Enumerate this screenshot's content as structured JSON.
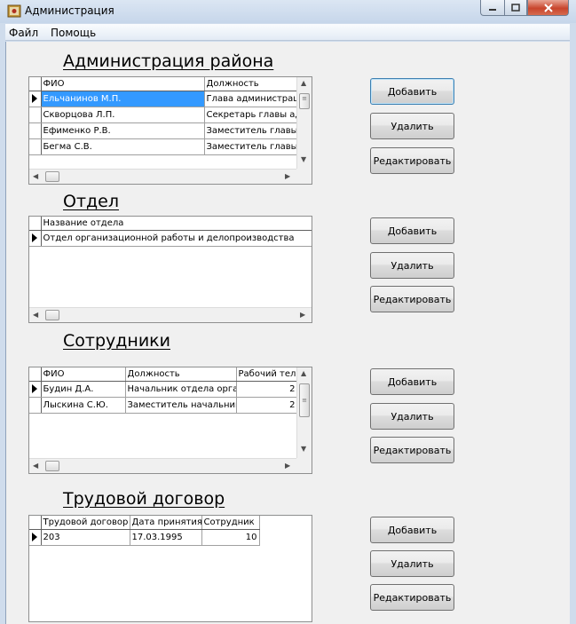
{
  "window": {
    "title": "Администрация"
  },
  "menu": {
    "file": "Файл",
    "help": "Помощь"
  },
  "buttons": {
    "add": "Добавить",
    "delete": "Удалить",
    "edit": "Редактировать"
  },
  "sections": {
    "admin": {
      "title": "Администрация района",
      "headers": [
        "ФИО",
        "Должность"
      ],
      "rows": [
        [
          "Ельчанинов М.П.",
          "Глава администрации"
        ],
        [
          "Скворцова Л.П.",
          "Секретарь главы администрации"
        ],
        [
          "Ефименко Р.В.",
          "Заместитель главы"
        ],
        [
          "Бегма С.В.",
          "Заместитель главы"
        ]
      ]
    },
    "department": {
      "title": "Отдел",
      "headers": [
        "Название отдела"
      ],
      "rows": [
        [
          "Отдел организационной работы и делопроизводства"
        ]
      ]
    },
    "employees": {
      "title": "Сотрудники",
      "headers": [
        "ФИО",
        "Должность",
        "Рабочий телефон"
      ],
      "rows": [
        [
          "Будин Д.А.",
          "Начальник отдела организационной работы",
          "2"
        ],
        [
          "Лыскина С.Ю.",
          "Заместитель начальника",
          "2"
        ]
      ]
    },
    "contract": {
      "title": "Трудовой договор",
      "headers": [
        "Трудовой договор",
        "Дата принятия",
        "Сотрудник"
      ],
      "rows": [
        [
          "203",
          "17.03.1995",
          "10"
        ]
      ]
    }
  }
}
